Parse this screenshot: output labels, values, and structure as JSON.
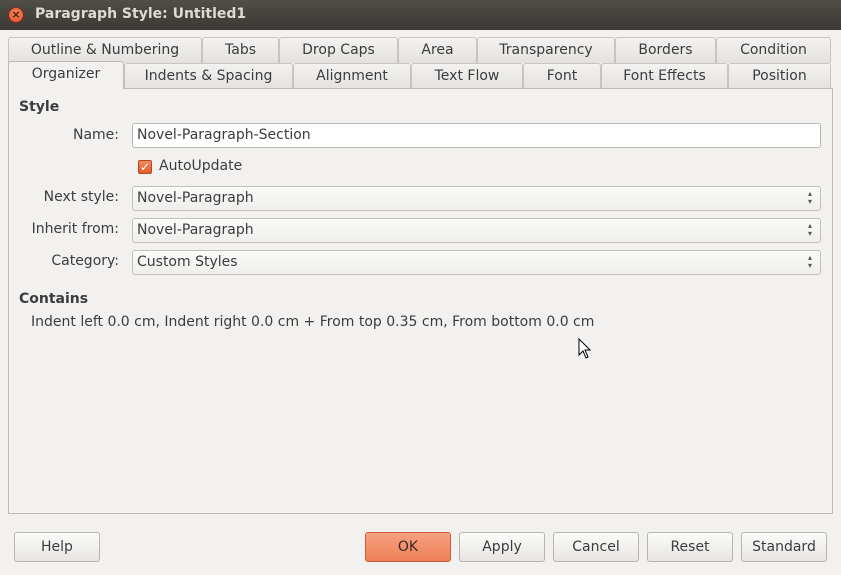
{
  "window": {
    "title": "Paragraph Style: Untitled1",
    "close_glyph": "×"
  },
  "tabs_row1": [
    "Outline & Numbering",
    "Tabs",
    "Drop Caps",
    "Area",
    "Transparency",
    "Borders",
    "Condition"
  ],
  "tabs_row2": [
    "Organizer",
    "Indents & Spacing",
    "Alignment",
    "Text Flow",
    "Font",
    "Font Effects",
    "Position"
  ],
  "active_tab": "Organizer",
  "style_section": {
    "title": "Style",
    "name_label": "Name:",
    "name_value": "Novel-Paragraph-Section",
    "autoupdate_label": "AutoUpdate",
    "autoupdate_checked": true,
    "next_style_label": "Next style:",
    "next_style_value": "Novel-Paragraph",
    "inherit_label": "Inherit from:",
    "inherit_value": "Novel-Paragraph",
    "category_label": "Category:",
    "category_value": "Custom Styles"
  },
  "contains_section": {
    "title": "Contains",
    "text": "Indent left 0.0 cm, Indent right 0.0 cm + From top 0.35 cm, From bottom 0.0 cm"
  },
  "buttons": {
    "help": "Help",
    "ok": "OK",
    "apply": "Apply",
    "cancel": "Cancel",
    "reset": "Reset",
    "standard": "Standard"
  },
  "colors": {
    "accent": "#ee7f57",
    "titlebar": "#3b3935"
  }
}
